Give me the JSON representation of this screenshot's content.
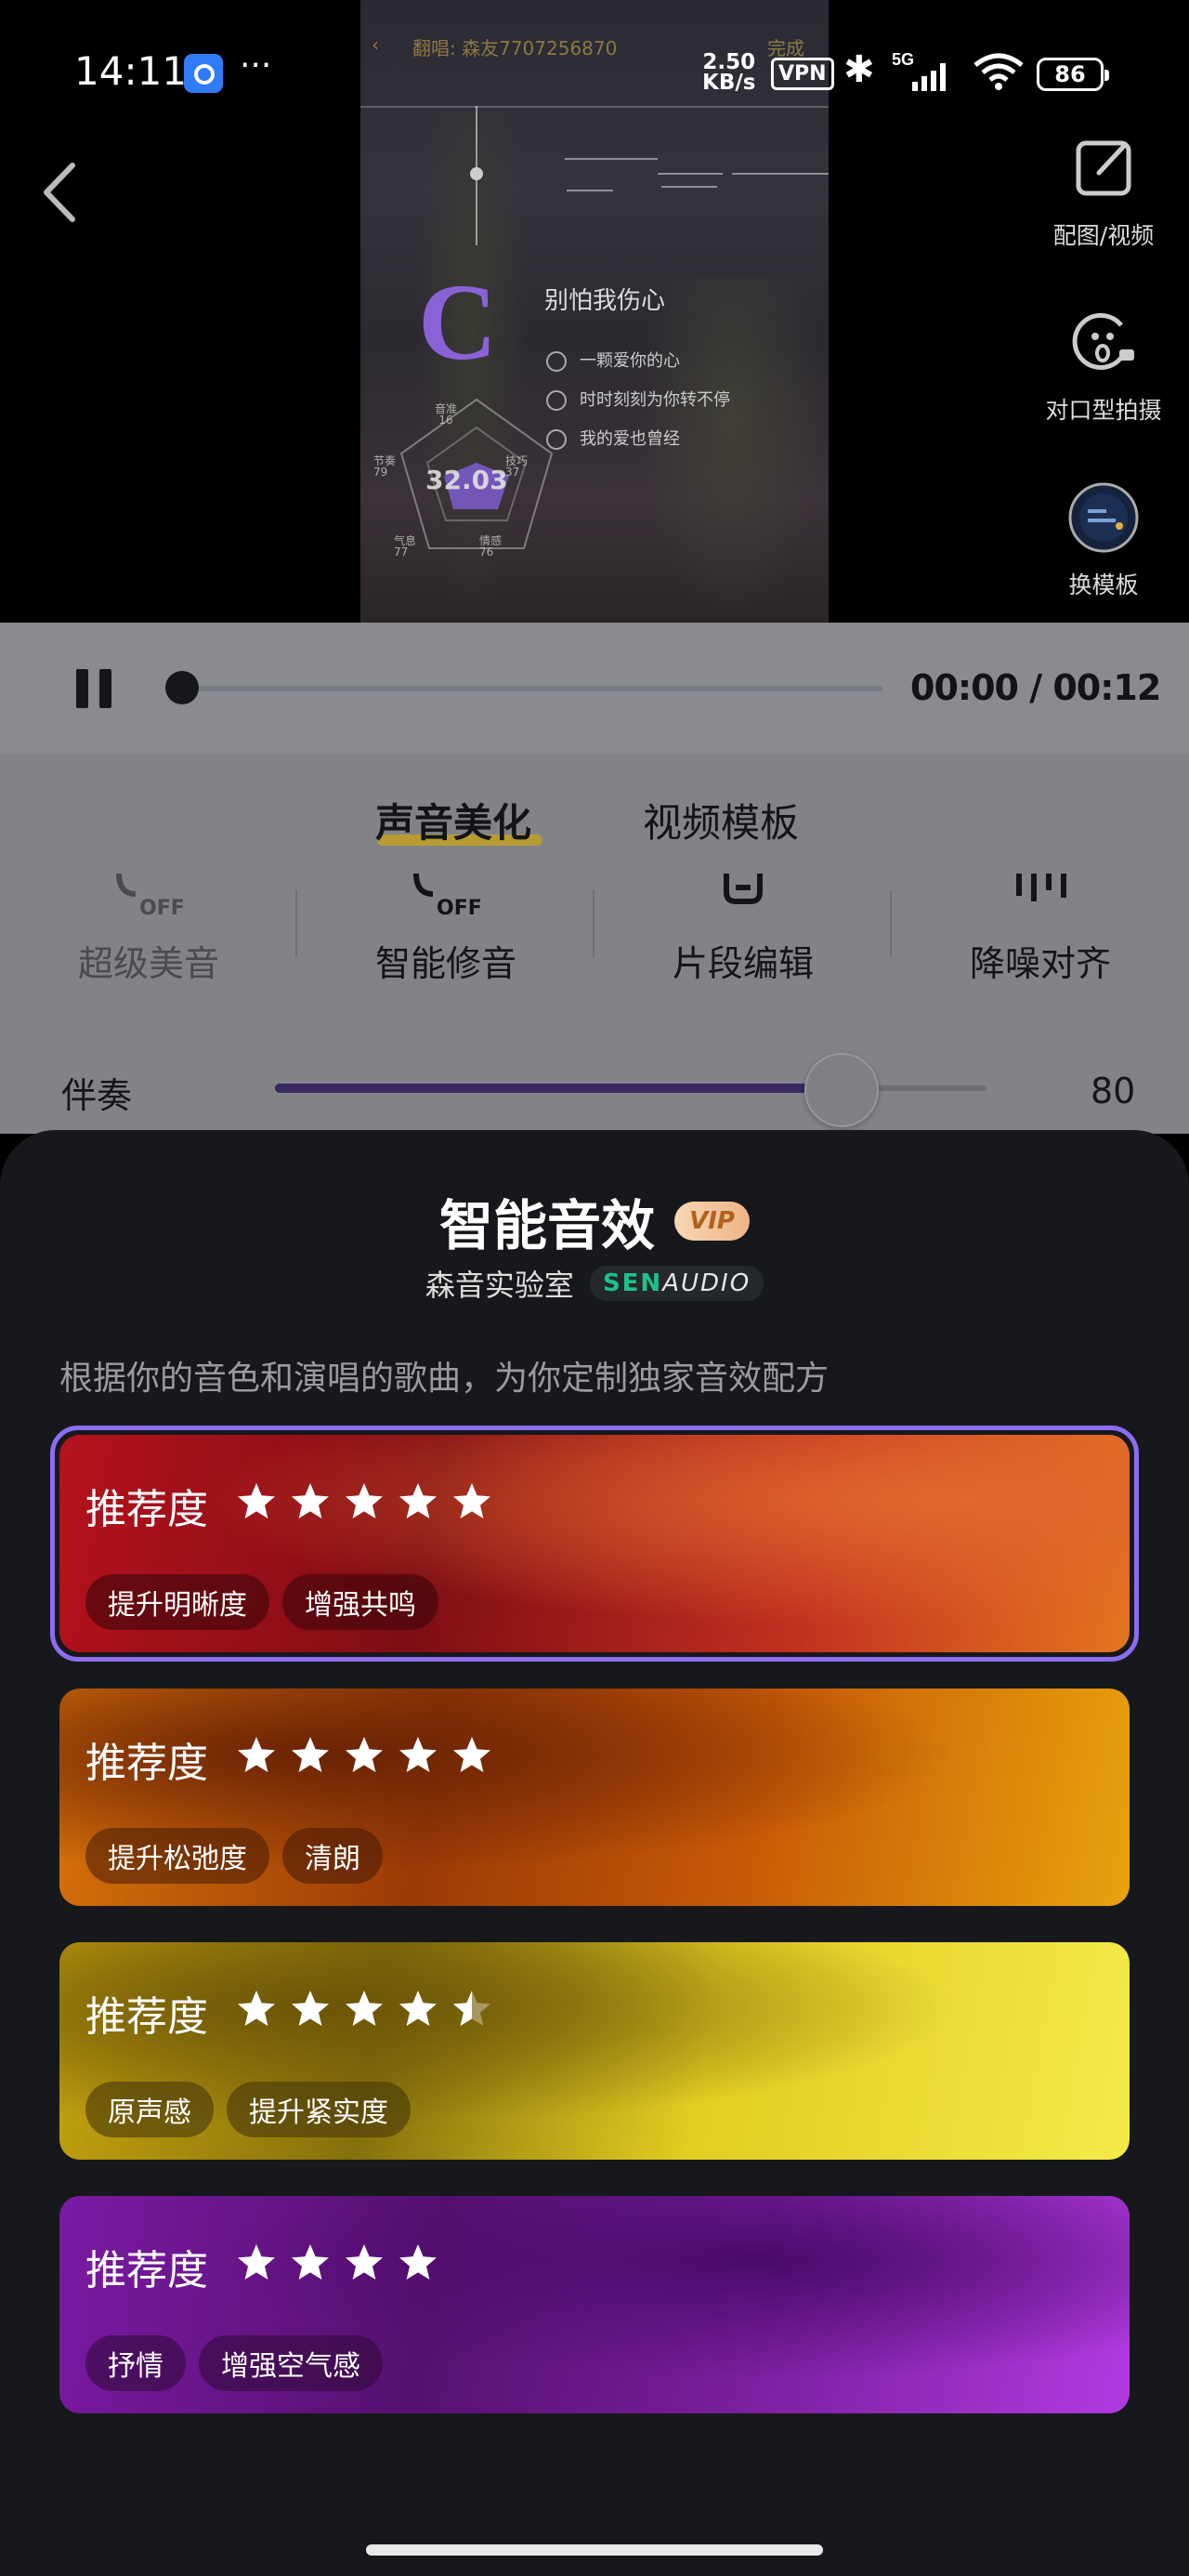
{
  "status_bar": {
    "time": "14:11",
    "more": "···",
    "net_speed_value": "2.50",
    "net_speed_unit": "KB/s",
    "vpn": "VPN",
    "signal": "5G",
    "battery": "86"
  },
  "video_preview": {
    "header_left": "翻唱: 森友7707256870",
    "header_right": "完成",
    "big_letter": "C",
    "song_title": "别怕我伤心",
    "lyrics": [
      "一颗爱你的心",
      "时时刻刻为你转不停",
      "我的爱也曾经"
    ],
    "score": "32.03",
    "radar_labels": [
      {
        "name": "音准",
        "value": "16"
      },
      {
        "name": "节奏",
        "value": "79"
      },
      {
        "name": "技巧",
        "value": "37"
      },
      {
        "name": "气息",
        "value": "77"
      },
      {
        "name": "情感",
        "value": "76"
      }
    ]
  },
  "side_actions": [
    {
      "label": "配图/视频",
      "icon": "edit-icon"
    },
    {
      "label": "对口型拍摄",
      "icon": "lip-sync-icon"
    },
    {
      "label": "换模板",
      "icon": "template-icon"
    }
  ],
  "player": {
    "current_time": "00:00",
    "separator": "/",
    "total_time": "00:12",
    "progress": 0
  },
  "tabs": [
    {
      "label": "声音美化",
      "active": true
    },
    {
      "label": "视频模板",
      "active": false
    }
  ],
  "tools": [
    {
      "label": "超级美音",
      "icon": "super-voice-off-icon"
    },
    {
      "label": "智能修音",
      "icon": "smart-tune-off-icon"
    },
    {
      "label": "片段编辑",
      "icon": "segment-edit-icon"
    },
    {
      "label": "降噪对齐",
      "icon": "denoise-align-icon"
    }
  ],
  "accompaniment": {
    "label": "伴奏",
    "value": "80",
    "fraction": 0.8
  },
  "sheet": {
    "title": "智能音效",
    "vip": "VIP",
    "lab_name": "森音实验室",
    "logo_part1": "SEN",
    "logo_part2": "AUDIO",
    "description": "根据你的音色和演唱的歌曲，为你定制独家音效配方",
    "cards": [
      {
        "label": "推荐度",
        "rating": 5,
        "tags": [
          "提升明晰度",
          "增强共鸣"
        ],
        "selected": true
      },
      {
        "label": "推荐度",
        "rating": 5,
        "tags": [
          "提升松弛度",
          "清朗"
        ],
        "selected": false
      },
      {
        "label": "推荐度",
        "rating": 4.5,
        "tags": [
          "原声感",
          "提升紧实度"
        ],
        "selected": false
      },
      {
        "label": "推荐度",
        "rating": 4,
        "tags": [
          "抒情",
          "增强空气感"
        ],
        "selected": false
      }
    ]
  },
  "colors": {
    "accent_purple": "#8b6cf2",
    "vip_text": "#b0621d",
    "sheet_bg": "#17181b"
  }
}
